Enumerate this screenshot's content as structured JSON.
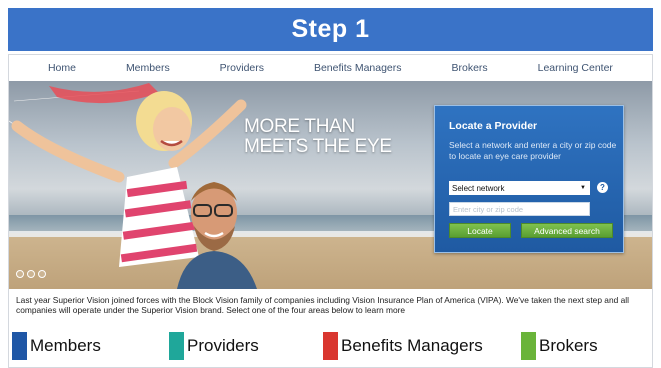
{
  "banner": {
    "title": "Step 1",
    "color": "#3a73c8"
  },
  "nav": {
    "items": [
      "Home",
      "Members",
      "Providers",
      "Benefits Managers",
      "Brokers",
      "Learning Center"
    ]
  },
  "hero": {
    "headline_line1": "MORE THAN",
    "headline_line2": "MEETS THE EYE",
    "slides": 3
  },
  "locator": {
    "title": "Locate a Provider",
    "description": "Select a network and enter a city or zip code to locate an eye care provider",
    "network_select": "Select network",
    "help_icon": "?",
    "city_placeholder": "Enter city or zip code",
    "locate_button": "Locate",
    "advanced_button": "Advanced search"
  },
  "intro": {
    "text": "Last year Superior Vision joined forces with the Block Vision family of companies including Vision Insurance Plan of America (VIPA). We've taken the next step and all companies will operate under the Superior Vision brand. Select one of the four areas below to learn more"
  },
  "areas": [
    {
      "label": "Members",
      "color": "#1f57a6"
    },
    {
      "label": "Providers",
      "color": "#1fa79a"
    },
    {
      "label": "Benefits Managers",
      "color": "#d9362f"
    },
    {
      "label": "Brokers",
      "color": "#6ab43a"
    }
  ]
}
